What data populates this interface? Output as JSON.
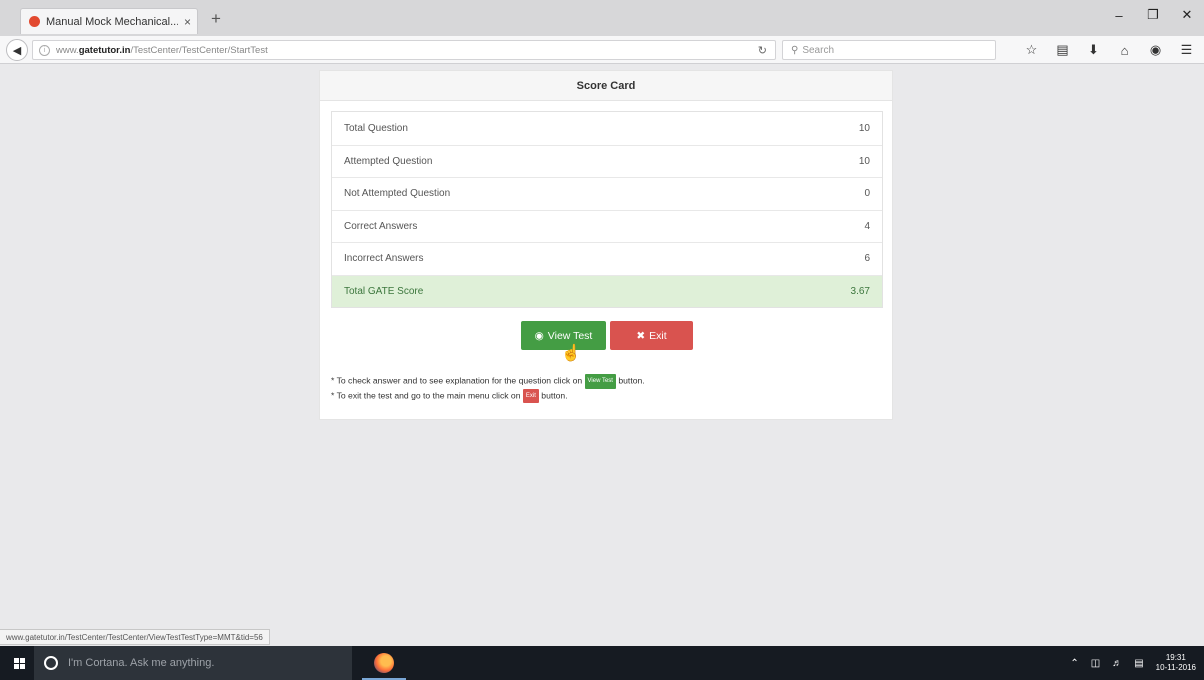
{
  "browser": {
    "tab_title": "Manual Mock Mechanical...",
    "tab_close": "×",
    "new_tab": "+",
    "url_prefix": "www.",
    "url_domain": "gatetutor.in",
    "url_path": "/TestCenter/TestCenter/StartTest",
    "search_placeholder": "Search",
    "status_url": "www.gatetutor.in/TestCenter/TestCenter/ViewTestTestType=MMT&tid=56"
  },
  "scorecard": {
    "title": "Score Card",
    "rows": [
      {
        "label": "Total Question",
        "value": "10"
      },
      {
        "label": "Attempted Question",
        "value": "10"
      },
      {
        "label": "Not Attempted Question",
        "value": "0"
      },
      {
        "label": "Correct Answers",
        "value": "4"
      },
      {
        "label": "Incorrect Answers",
        "value": "6"
      },
      {
        "label": "Total GATE Score",
        "value": "3.67"
      }
    ],
    "view_test_label": "View Test",
    "exit_label": "Exit",
    "note1_pre": "* To check answer and to see explanation for the question click on",
    "note1_badge": "View Test",
    "note1_post": "button.",
    "note2_pre": "* To exit the test and go to the main menu click on",
    "note2_badge": "Exit",
    "note2_post": "button."
  },
  "taskbar": {
    "cortana_placeholder": "I'm Cortana. Ask me anything.",
    "time": "19:31",
    "date": "10-11-2016"
  },
  "colors": {
    "success": "#449d44",
    "danger": "#d9534f",
    "total_row_bg": "#dff0d8"
  }
}
